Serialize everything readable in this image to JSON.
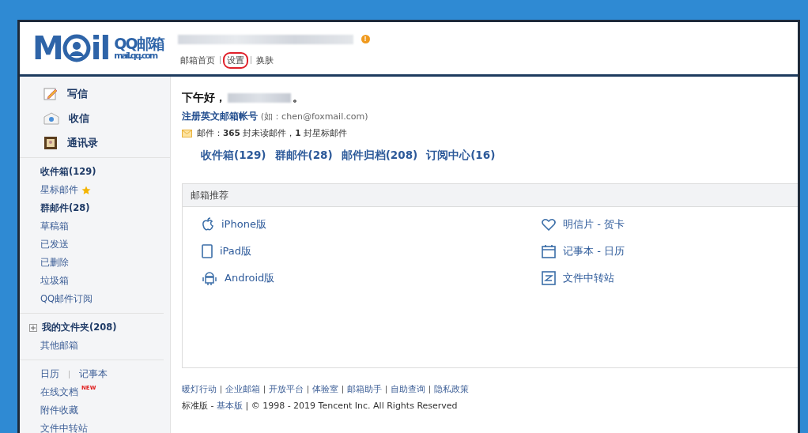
{
  "header": {
    "logo_left": "M",
    "logo_right": "il",
    "brand": "QQ邮箱",
    "domain": "mail.qq.com",
    "alert": "!",
    "nav": [
      {
        "label": "邮箱首页",
        "highlighted": false
      },
      {
        "label": "设置",
        "highlighted": true
      },
      {
        "label": "换肤",
        "highlighted": false
      }
    ]
  },
  "sidebar": {
    "actions": [
      {
        "label": "写信",
        "kind": "compose"
      },
      {
        "label": "收信",
        "kind": "inbox"
      },
      {
        "label": "通讯录",
        "kind": "contacts"
      }
    ],
    "folders": [
      {
        "label": "收件箱(129)",
        "bold": true,
        "starred": false
      },
      {
        "label": "星标邮件",
        "bold": false,
        "starred": true
      },
      {
        "label": "群邮件(28)",
        "bold": true,
        "starred": false
      },
      {
        "label": "草稿箱",
        "bold": false,
        "starred": false
      },
      {
        "label": "已发送",
        "bold": false,
        "starred": false
      },
      {
        "label": "已删除",
        "bold": false,
        "starred": false
      },
      {
        "label": "垃圾箱",
        "bold": false,
        "starred": false
      },
      {
        "label": "QQ邮件订阅",
        "bold": false,
        "starred": false
      }
    ],
    "my_folders": {
      "label": "我的文件夹(208)",
      "expanded": false
    },
    "other": "其他邮箱",
    "tools": [
      {
        "links": [
          "日历",
          "记事本"
        ]
      },
      {
        "links": [
          "在线文档"
        ],
        "badge": "NEW"
      },
      {
        "links": [
          "附件收藏"
        ]
      },
      {
        "links": [
          "文件中转站"
        ]
      }
    ]
  },
  "main": {
    "greeting": "下午好，",
    "greeting_end": "。",
    "register_link": "注册英文邮箱帐号",
    "register_hint": "(如：chen@foxmail.com)",
    "summary": "邮件：**365** 封未读邮件，**1** 封星标邮件",
    "quick_links": [
      "收件箱(129)",
      "群邮件(28)",
      "邮件归档(208)",
      "订阅中心(16)"
    ],
    "recommend": {
      "title": "邮箱推荐",
      "items": [
        {
          "label": "iPhone版",
          "kind": "apple"
        },
        {
          "label": "明信片 - 贺卡",
          "kind": "heart"
        },
        {
          "label": "iPad版",
          "kind": "tablet"
        },
        {
          "label": "记事本 - 日历",
          "kind": "calendar"
        },
        {
          "label": "Android版",
          "kind": "android"
        },
        {
          "label": "文件中转站",
          "kind": "transfer"
        }
      ]
    },
    "footer_links": [
      "暖灯行动",
      "企业邮箱",
      "开放平台",
      "体验室",
      "邮箱助手",
      "自助查询",
      "隐私政策"
    ],
    "edition": "标准版 - ",
    "basic_link": "基本版",
    "copyright": " | © 1998 - 2019 Tencent Inc. All Rights Reserved"
  }
}
